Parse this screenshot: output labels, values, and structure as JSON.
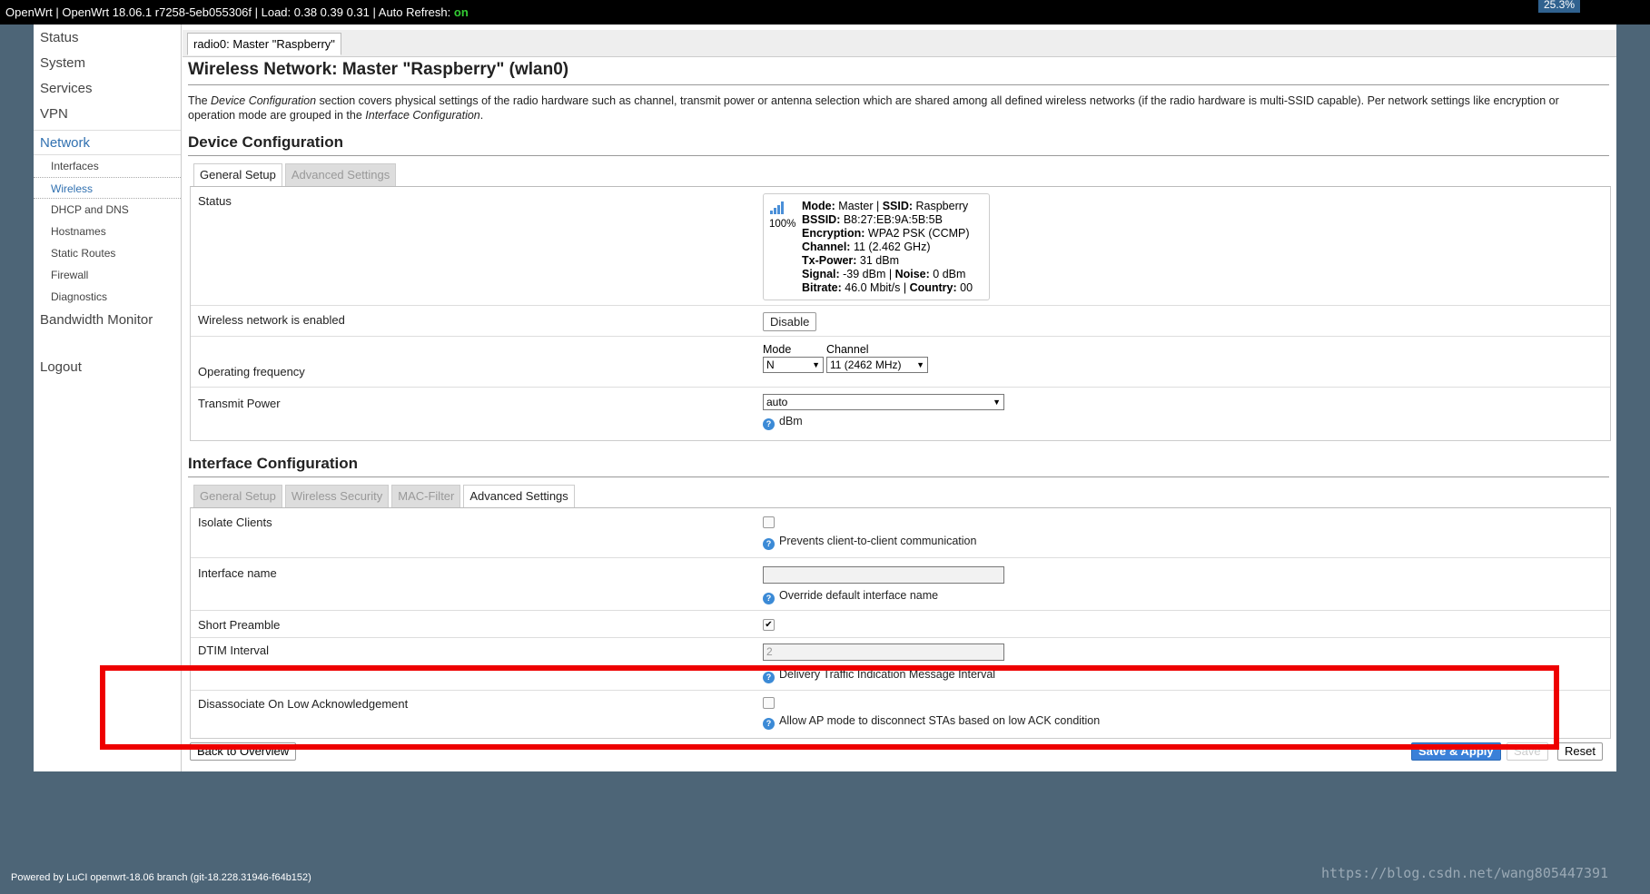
{
  "header": {
    "text": "OpenWrt | OpenWrt 18.06.1 r7258-5eb055306f | Load: 0.38 0.39 0.31 | Auto Refresh: ",
    "auto_refresh_state": "on",
    "load_badge": "25.3%"
  },
  "sidebar": {
    "items": [
      "Status",
      "System",
      "Services",
      "VPN"
    ],
    "network": "Network",
    "network_sub": [
      "Interfaces",
      "Wireless",
      "DHCP and DNS",
      "Hostnames",
      "Static Routes",
      "Firewall",
      "Diagnostics"
    ],
    "bandwidth": "Bandwidth Monitor",
    "logout": "Logout"
  },
  "top_tab": "radio0: Master \"Raspberry\"",
  "page_title": "Wireless Network: Master \"Raspberry\" (wlan0)",
  "description": {
    "p1": "The ",
    "em1": "Device Configuration",
    "p2": " section covers physical settings of the radio hardware such as channel, transmit power or antenna selection which are shared among all defined wireless networks (if the radio hardware is multi-SSID capable). Per network settings like encryption or operation mode are grouped in the ",
    "em2": "Interface Configuration",
    "p3": "."
  },
  "device_config": {
    "title": "Device Configuration",
    "tabs": [
      "General Setup",
      "Advanced Settings"
    ],
    "status_label": "Status",
    "status": {
      "signal_percent": "100%",
      "mode_k": "Mode:",
      "mode_v": " Master | ",
      "ssid_k": "SSID:",
      "ssid_v": " Raspberry",
      "bssid_k": "BSSID:",
      "bssid_v": " B8:27:EB:9A:5B:5B",
      "enc_k": "Encryption:",
      "enc_v": " WPA2 PSK (CCMP)",
      "chan_k": "Channel:",
      "chan_v": " 11 (2.462 GHz)",
      "tx_k": "Tx-Power:",
      "tx_v": " 31 dBm",
      "sig_k": "Signal:",
      "sig_v": " -39 dBm | ",
      "noise_k": "Noise:",
      "noise_v": " 0 dBm",
      "bit_k": "Bitrate:",
      "bit_v": " 46.0 Mbit/s | ",
      "country_k": "Country:",
      "country_v": " 00"
    },
    "enabled_label": "Wireless network is enabled",
    "disable_button": "Disable",
    "freq_label": "Operating frequency",
    "mode_label": "Mode",
    "mode_value": "N",
    "channel_label": "Channel",
    "channel_value": "11 (2462 MHz)",
    "txpower_label": "Transmit Power",
    "txpower_value": "auto",
    "txpower_unit": "dBm"
  },
  "interface_config": {
    "title": "Interface Configuration",
    "tabs": [
      "General Setup",
      "Wireless Security",
      "MAC-Filter",
      "Advanced Settings"
    ],
    "isolate_label": "Isolate Clients",
    "isolate_help": "Prevents client-to-client communication",
    "ifname_label": "Interface name",
    "ifname_help": "Override default interface name",
    "short_preamble_label": "Short Preamble",
    "dtim_label": "DTIM Interval",
    "dtim_placeholder": "2",
    "dtim_help": "Delivery Traffic Indication Message Interval",
    "disassoc_label": "Disassociate On Low Acknowledgement",
    "disassoc_help": "Allow AP mode to disconnect STAs based on low ACK condition"
  },
  "actions": {
    "back": "Back to Overview",
    "save_apply": "Save & Apply",
    "save": "Save",
    "reset": "Reset"
  },
  "footer": "Powered by LuCI openwrt-18.06 branch (git-18.228.31946-f64b152)",
  "watermark": "https://blog.csdn.net/wang805447391",
  "colors": {
    "accent": "#3070b0",
    "highlight": "#ee0000",
    "background": "#4d6577"
  }
}
